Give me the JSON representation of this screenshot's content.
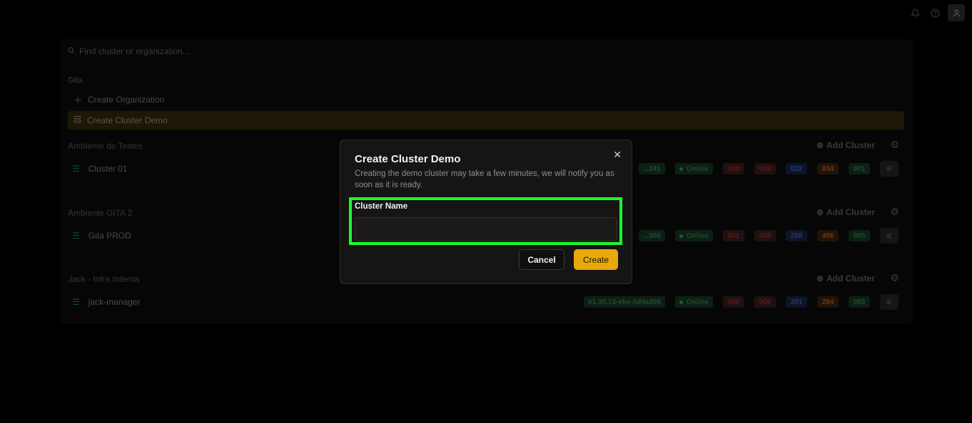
{
  "topbar": {
    "icons": [
      "bell-icon",
      "help-icon",
      "user-icon"
    ]
  },
  "page": {
    "search_placeholder": "Find cluster or organization...",
    "org_label": "Gita",
    "commands": [
      {
        "icon": "plus-icon",
        "label": "Create Organization"
      },
      {
        "icon": "cluster-stack-icon",
        "label": "Create Cluster Demo"
      }
    ],
    "add_cluster_label": "Add Cluster",
    "sections": [
      {
        "title": "Ambiente de Testes",
        "cluster": {
          "name": "Cluster 01",
          "version": "...341",
          "status": "Online",
          "counts": [
            "000",
            "000",
            "022",
            "034",
            "001"
          ]
        }
      },
      {
        "title": "Ambiente GITA 2",
        "cluster": {
          "name": "Gita PROD",
          "version": "...308",
          "status": "Online",
          "counts": [
            "001",
            "000",
            "288",
            "406",
            "005"
          ]
        }
      },
      {
        "title": "Jack - Infra Interna",
        "cluster": {
          "name": "jack-manager",
          "version": "v1.30.13-eks-5d4a308",
          "status": "Online",
          "counts": [
            "000",
            "000",
            "201",
            "294",
            "003"
          ]
        }
      }
    ]
  },
  "modal": {
    "title": "Create Cluster Demo",
    "description": "Creating the demo cluster may take a few minutes, we will notify you as soon as it is ready.",
    "field_label": "Cluster Name",
    "field_value": "",
    "field_placeholder": "",
    "cancel_label": "Cancel",
    "create_label": "Create",
    "close_glyph": "✕"
  },
  "colors": {
    "accent": "#e8a90c",
    "highlight": "#19ff2a",
    "online": "#1b5b30"
  }
}
